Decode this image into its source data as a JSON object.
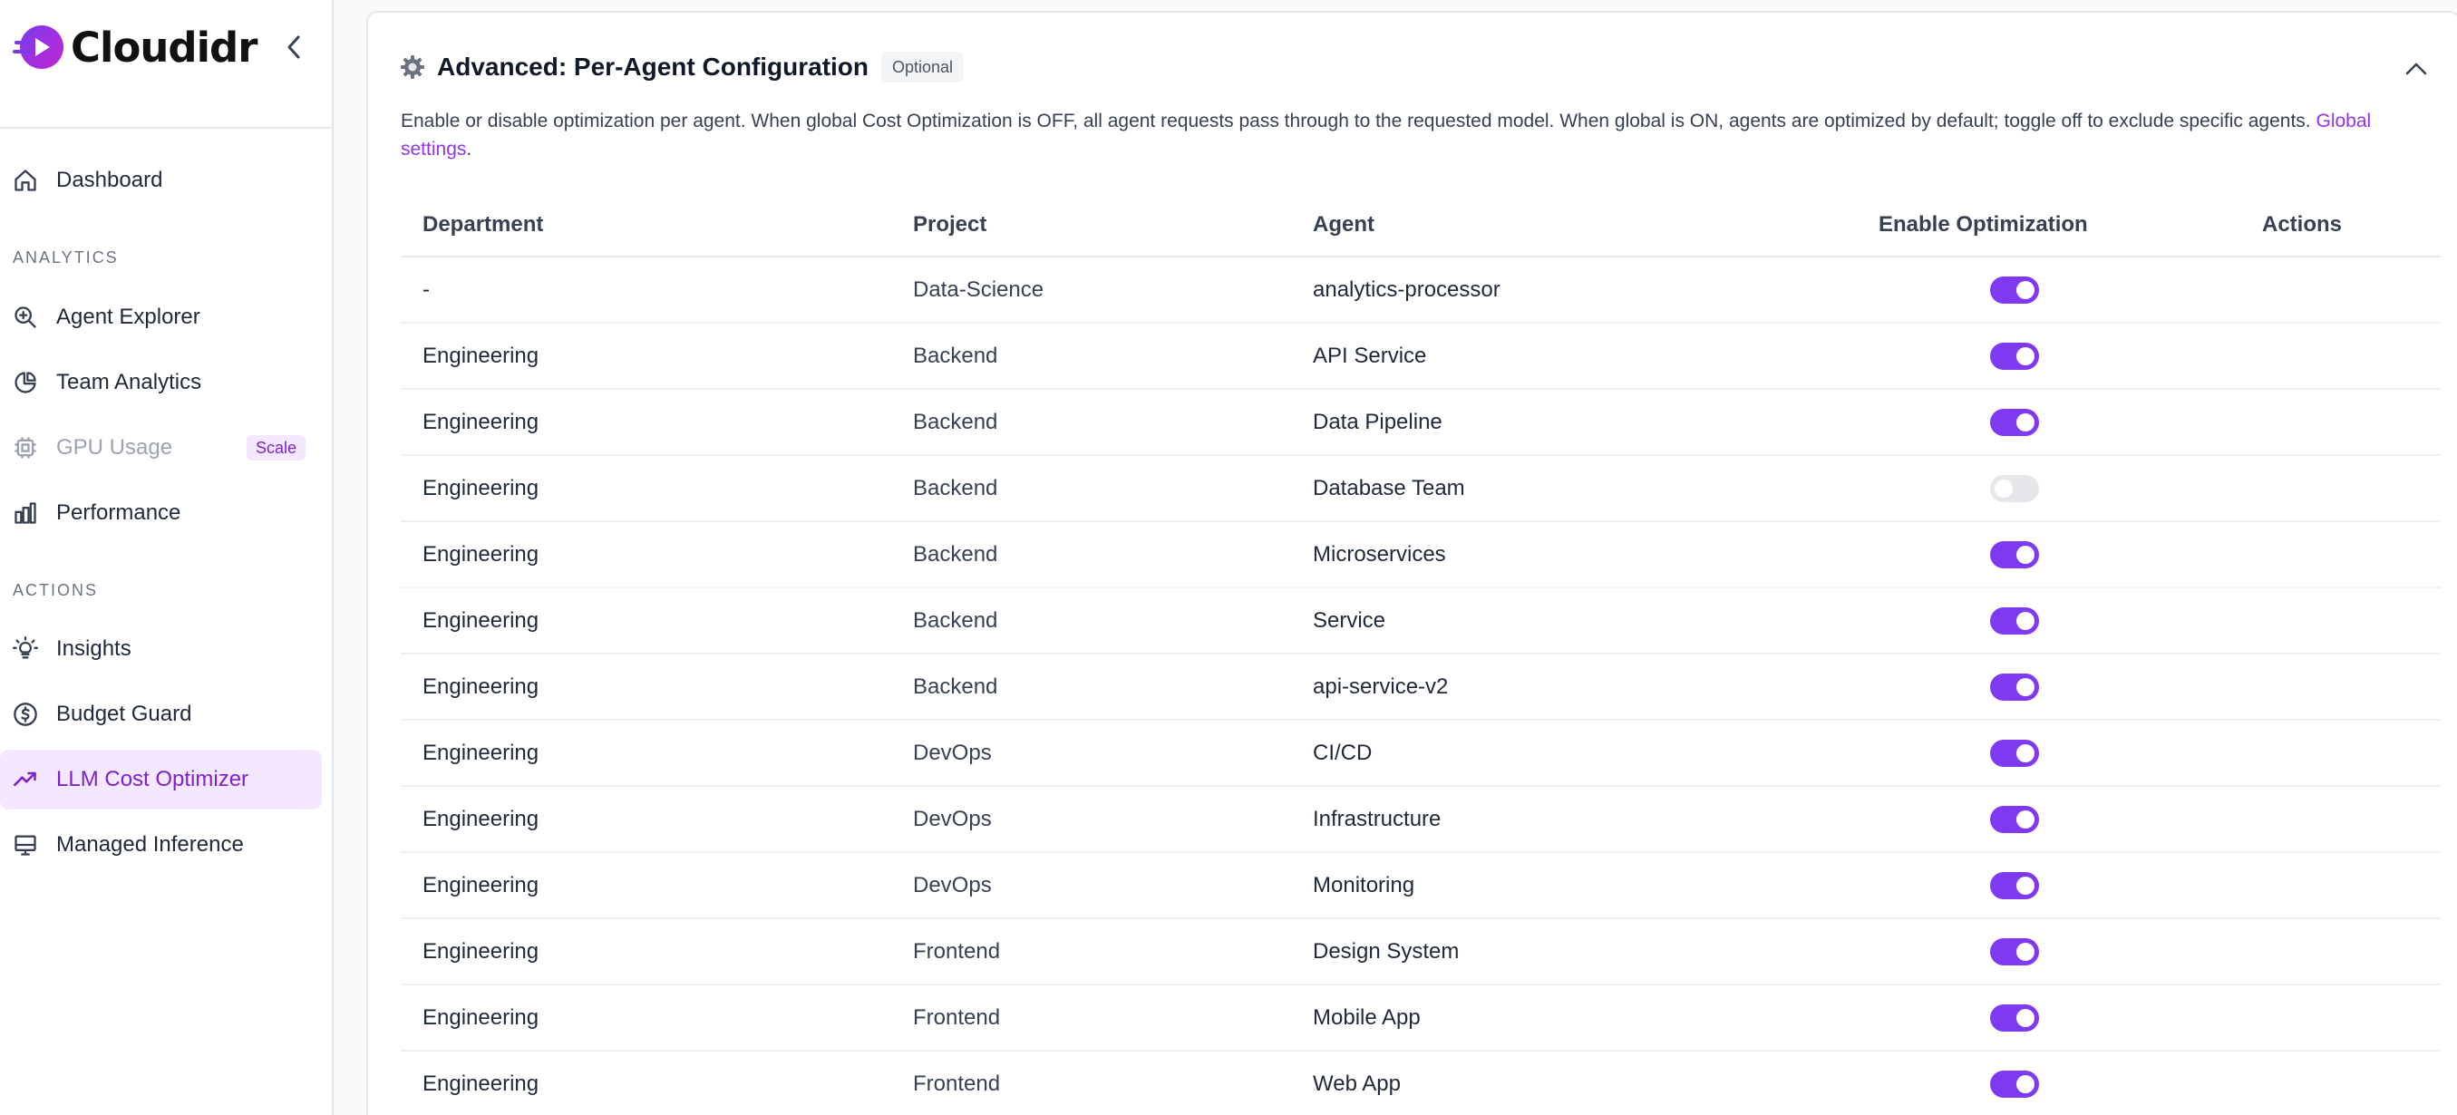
{
  "brand": {
    "name": "Cloudidr"
  },
  "sidebar": {
    "sections": {
      "analytics": "ANALYTICS",
      "actions": "ACTIONS"
    },
    "items": [
      {
        "label": "Dashboard",
        "icon": "home-icon"
      },
      {
        "label": "Agent Explorer",
        "icon": "search-zoom-icon"
      },
      {
        "label": "Team Analytics",
        "icon": "pie-chart-icon"
      },
      {
        "label": "GPU Usage",
        "icon": "cpu-icon",
        "badge": "Scale",
        "disabled": true
      },
      {
        "label": "Performance",
        "icon": "bar-chart-icon"
      },
      {
        "label": "Insights",
        "icon": "lightbulb-icon"
      },
      {
        "label": "Budget Guard",
        "icon": "dollar-circle-icon"
      },
      {
        "label": "LLM Cost Optimizer",
        "icon": "trending-up-icon",
        "active": true
      },
      {
        "label": "Managed Inference",
        "icon": "monitor-icon"
      }
    ]
  },
  "card": {
    "title": "Advanced: Per-Agent Configuration",
    "badge": "Optional",
    "description": "Enable or disable optimization per agent. When global Cost Optimization is OFF, all agent requests pass through to the requested model. When global is ON, agents are optimized by default; toggle off to exclude specific agents.",
    "link_label": "Global settings",
    "link_suffix": "."
  },
  "table": {
    "headers": {
      "department": "Department",
      "project": "Project",
      "agent": "Agent",
      "enable": "Enable Optimization",
      "actions": "Actions"
    },
    "rows": [
      {
        "department": "-",
        "project": "Data-Science",
        "agent": "analytics-processor",
        "enabled": true
      },
      {
        "department": "Engineering",
        "project": "Backend",
        "agent": "API Service",
        "enabled": true
      },
      {
        "department": "Engineering",
        "project": "Backend",
        "agent": "Data Pipeline",
        "enabled": true
      },
      {
        "department": "Engineering",
        "project": "Backend",
        "agent": "Database Team",
        "enabled": false
      },
      {
        "department": "Engineering",
        "project": "Backend",
        "agent": "Microservices",
        "enabled": true
      },
      {
        "department": "Engineering",
        "project": "Backend",
        "agent": "Service",
        "enabled": true
      },
      {
        "department": "Engineering",
        "project": "Backend",
        "agent": "api-service-v2",
        "enabled": true
      },
      {
        "department": "Engineering",
        "project": "DevOps",
        "agent": "CI/CD",
        "enabled": true
      },
      {
        "department": "Engineering",
        "project": "DevOps",
        "agent": "Infrastructure",
        "enabled": true
      },
      {
        "department": "Engineering",
        "project": "DevOps",
        "agent": "Monitoring",
        "enabled": true
      },
      {
        "department": "Engineering",
        "project": "Frontend",
        "agent": "Design System",
        "enabled": true
      },
      {
        "department": "Engineering",
        "project": "Frontend",
        "agent": "Mobile App",
        "enabled": true
      },
      {
        "department": "Engineering",
        "project": "Frontend",
        "agent": "Web App",
        "enabled": true
      }
    ]
  },
  "colors": {
    "accent": "#7e3af2",
    "active_bg": "#f3e8ff",
    "brand_gradient_start": "#7c3aed",
    "brand_gradient_end": "#c026d3"
  }
}
